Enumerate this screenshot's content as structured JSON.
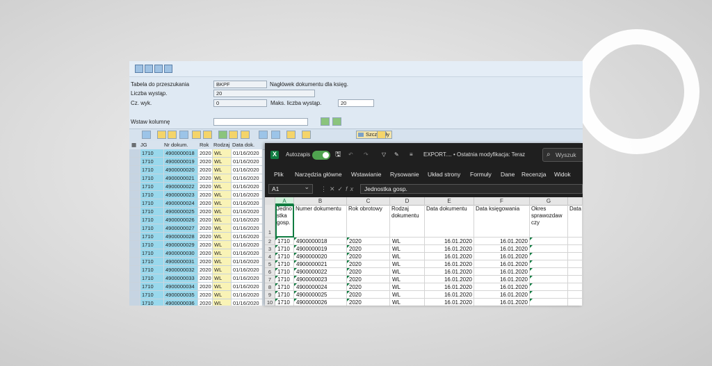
{
  "sap": {
    "sel": {
      "table_label": "Tabela do przeszukania",
      "table_value": "BKPF",
      "table_desc": "Nagłówek dokumentu dla księg.",
      "hits_label": "Liczba wystąp.",
      "hits_value": "20",
      "time_label": "Cz. wyk.",
      "time_value": "0",
      "max_label": "Maks. liczba wystąp.",
      "max_value": "20",
      "insert_col_label": "Wstaw kolumnę"
    },
    "details_button": "Szczegóły",
    "columns": [
      "JG",
      "Nr dokum.",
      "Rok",
      "Rodzaj",
      "Data dok."
    ],
    "rows": [
      [
        "1710",
        "4900000018",
        "2020",
        "WL",
        "01/16/2020"
      ],
      [
        "1710",
        "4900000019",
        "2020",
        "WL",
        "01/16/2020"
      ],
      [
        "1710",
        "4900000020",
        "2020",
        "WL",
        "01/16/2020"
      ],
      [
        "1710",
        "4900000021",
        "2020",
        "WL",
        "01/16/2020"
      ],
      [
        "1710",
        "4900000022",
        "2020",
        "WL",
        "01/16/2020"
      ],
      [
        "1710",
        "4900000023",
        "2020",
        "WL",
        "01/16/2020"
      ],
      [
        "1710",
        "4900000024",
        "2020",
        "WL",
        "01/16/2020"
      ],
      [
        "1710",
        "4900000025",
        "2020",
        "WL",
        "01/16/2020"
      ],
      [
        "1710",
        "4900000026",
        "2020",
        "WL",
        "01/16/2020"
      ],
      [
        "1710",
        "4900000027",
        "2020",
        "WL",
        "01/16/2020"
      ],
      [
        "1710",
        "4900000028",
        "2020",
        "WL",
        "01/16/2020"
      ],
      [
        "1710",
        "4900000029",
        "2020",
        "WL",
        "01/16/2020"
      ],
      [
        "1710",
        "4900000030",
        "2020",
        "WL",
        "01/16/2020"
      ],
      [
        "1710",
        "4900000031",
        "2020",
        "WL",
        "01/16/2020"
      ],
      [
        "1710",
        "4900000032",
        "2020",
        "WL",
        "01/16/2020"
      ],
      [
        "1710",
        "4900000033",
        "2020",
        "WL",
        "01/16/2020"
      ],
      [
        "1710",
        "4900000034",
        "2020",
        "WL",
        "01/16/2020"
      ],
      [
        "1710",
        "4900000035",
        "2020",
        "WL",
        "01/16/2020"
      ],
      [
        "1710",
        "4900000036",
        "2020",
        "WL",
        "01/16/2020"
      ]
    ]
  },
  "excel": {
    "autosave_label": "Autozapis",
    "doc_title": "EXPORT....",
    "doc_status": "• Ostatnia modyfikacja: Teraz",
    "search_placeholder": "Wyszuk",
    "ribbon_tabs": [
      "Plik",
      "Narzędzia główne",
      "Wstawianie",
      "Rysowanie",
      "Układ strony",
      "Formuły",
      "Dane",
      "Recenzja",
      "Widok"
    ],
    "name_box": "A1",
    "formula": "Jednostka gosp.",
    "col_letters": [
      "A",
      "B",
      "C",
      "D",
      "E",
      "F",
      "G"
    ],
    "headers": [
      "Jedno stka gosp.",
      "Numer dokumentu",
      "Rok obrotowy",
      "Rodzaj dokumentu",
      "Data dokumentu",
      "Data księgowania",
      "Okres sprawozdaw czy",
      "Data"
    ],
    "rows": [
      [
        "1710",
        "4900000018",
        "2020",
        "WL",
        "16.01.2020",
        "16.01.2020"
      ],
      [
        "1710",
        "4900000019",
        "2020",
        "WL",
        "16.01.2020",
        "16.01.2020"
      ],
      [
        "1710",
        "4900000020",
        "2020",
        "WL",
        "16.01.2020",
        "16.01.2020"
      ],
      [
        "1710",
        "4900000021",
        "2020",
        "WL",
        "16.01.2020",
        "16.01.2020"
      ],
      [
        "1710",
        "4900000022",
        "2020",
        "WL",
        "16.01.2020",
        "16.01.2020"
      ],
      [
        "1710",
        "4900000023",
        "2020",
        "WL",
        "16.01.2020",
        "16.01.2020"
      ],
      [
        "1710",
        "4900000024",
        "2020",
        "WL",
        "16.01.2020",
        "16.01.2020"
      ],
      [
        "1710",
        "4900000025",
        "2020",
        "WL",
        "16.01.2020",
        "16.01.2020"
      ],
      [
        "1710",
        "4900000026",
        "2020",
        "WL",
        "16.01.2020",
        "16.01.2020"
      ]
    ],
    "row_numbers": [
      "1",
      "2",
      "3",
      "4",
      "5",
      "6",
      "7",
      "8",
      "9",
      "10"
    ]
  }
}
